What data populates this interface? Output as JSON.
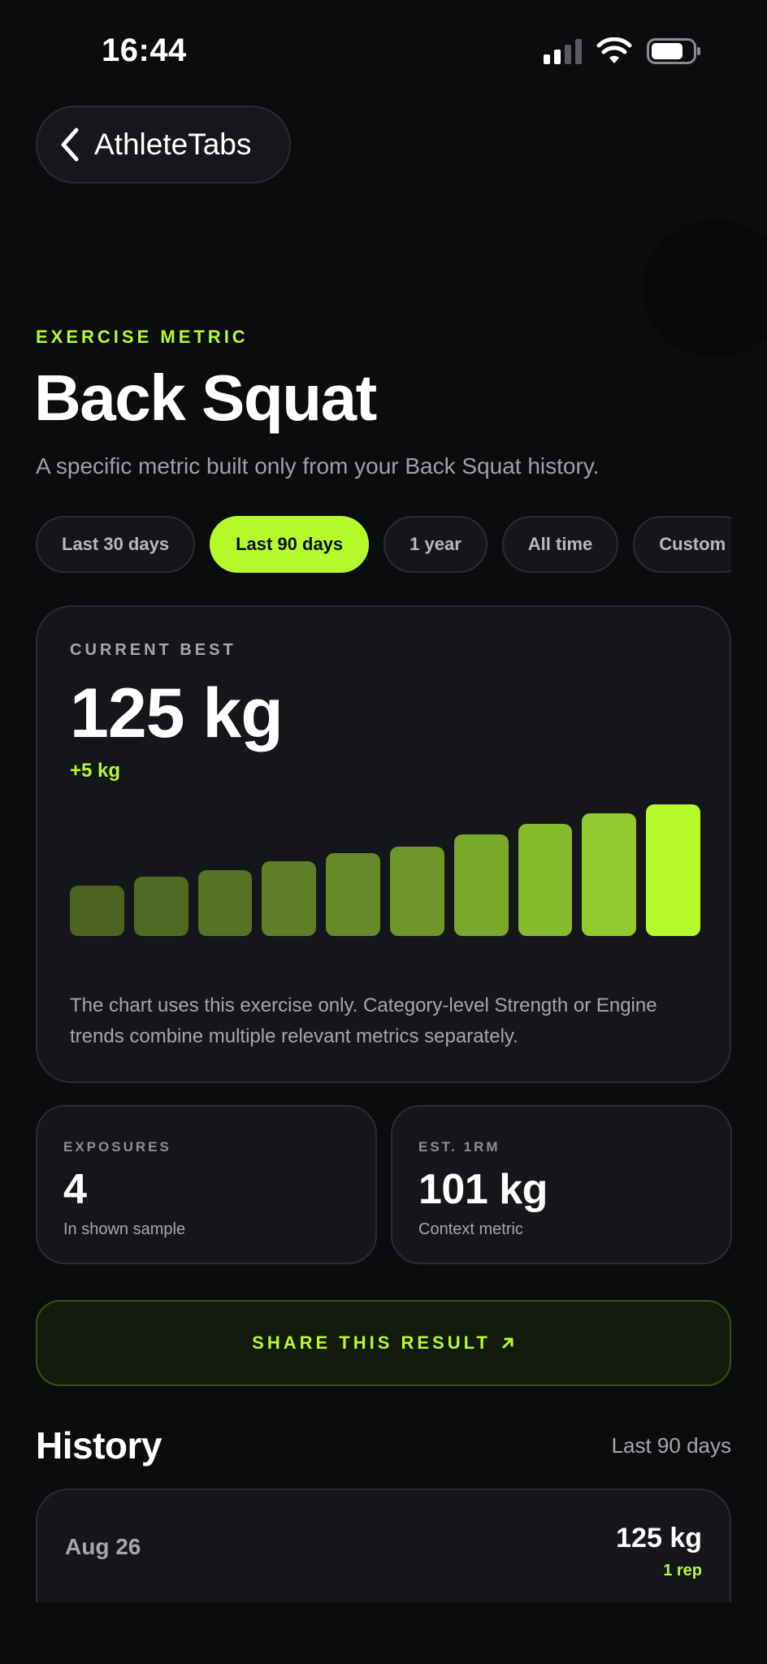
{
  "status": {
    "time": "16:44"
  },
  "nav": {
    "back_label": "AthleteTabs"
  },
  "header": {
    "eyebrow": "EXERCISE METRIC",
    "title": "Back Squat",
    "subtitle": "A specific metric built only from your Back Squat history."
  },
  "ranges": [
    {
      "label": "Last 30 days",
      "active": false
    },
    {
      "label": "Last 90 days",
      "active": true
    },
    {
      "label": "1 year",
      "active": false
    },
    {
      "label": "All time",
      "active": false
    },
    {
      "label": "Custom",
      "active": false
    }
  ],
  "best": {
    "label": "CURRENT BEST",
    "value": "125 kg",
    "delta": "+5 kg",
    "note": "The chart uses this exercise only. Category-level Strength or Engine trends combine multiple relevant metrics separately."
  },
  "chart_data": {
    "type": "bar",
    "values": [
      0.38,
      0.45,
      0.5,
      0.57,
      0.63,
      0.68,
      0.77,
      0.85,
      0.93,
      1.0
    ],
    "colors": [
      "#4c6321",
      "#506923",
      "#567225",
      "#5e7e27",
      "#66892a",
      "#6e962b",
      "#7aa82c",
      "#86bb2d",
      "#93cb2e",
      "#b5fb2c"
    ]
  },
  "stats": [
    {
      "label": "EXPOSURES",
      "value": "4",
      "sub": "In shown sample"
    },
    {
      "label": "EST. 1RM",
      "value": "101 kg",
      "sub": "Context metric"
    }
  ],
  "share": {
    "label": "SHARE THIS RESULT"
  },
  "history": {
    "title": "History",
    "range": "Last 90 days",
    "rows": [
      {
        "date": "Aug 26",
        "value": "125 kg",
        "reps": "1 rep"
      }
    ]
  },
  "colors": {
    "accent": "#b5fb2c",
    "background": "#0b0c0e",
    "card": "#14161a"
  }
}
